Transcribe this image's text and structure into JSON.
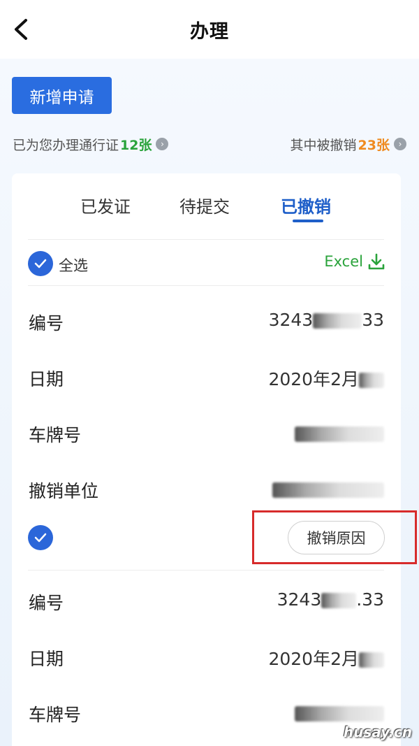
{
  "header": {
    "title": "办理"
  },
  "actions": {
    "new_application": "新增申请"
  },
  "stats": {
    "issued_text": "已为您办理通行证",
    "issued_count": "12张",
    "revoked_text": "其中被撤销",
    "revoked_count": "23张"
  },
  "tabs": [
    {
      "label": "已发证",
      "active": false
    },
    {
      "label": "待提交",
      "active": false
    },
    {
      "label": "已撤销",
      "active": true
    }
  ],
  "toolbar": {
    "select_all": "全选",
    "excel_label": "Excel"
  },
  "records": [
    {
      "fields": [
        {
          "label": "编号",
          "value_prefix": "3243",
          "value_suffix": "33"
        },
        {
          "label": "日期",
          "value_prefix": "2020年2月",
          "value_suffix": ""
        },
        {
          "label": "车牌号",
          "value_prefix": "",
          "value_suffix": ""
        },
        {
          "label": "撤销单位",
          "value_prefix": "",
          "value_suffix": ""
        }
      ],
      "reason_button": "撤销原因"
    },
    {
      "fields": [
        {
          "label": "编号",
          "value_prefix": "3243",
          "value_suffix": ".33"
        },
        {
          "label": "日期",
          "value_prefix": "2020年2月",
          "value_suffix": ""
        },
        {
          "label": "车牌号",
          "value_prefix": "",
          "value_suffix": ""
        }
      ]
    }
  ],
  "watermark": "husay.cn",
  "colors": {
    "primary": "#2a6de0",
    "tab_active": "#1f5fc9",
    "green": "#2aa33b",
    "orange": "#ef8a1f",
    "highlight": "#d72b2b"
  }
}
